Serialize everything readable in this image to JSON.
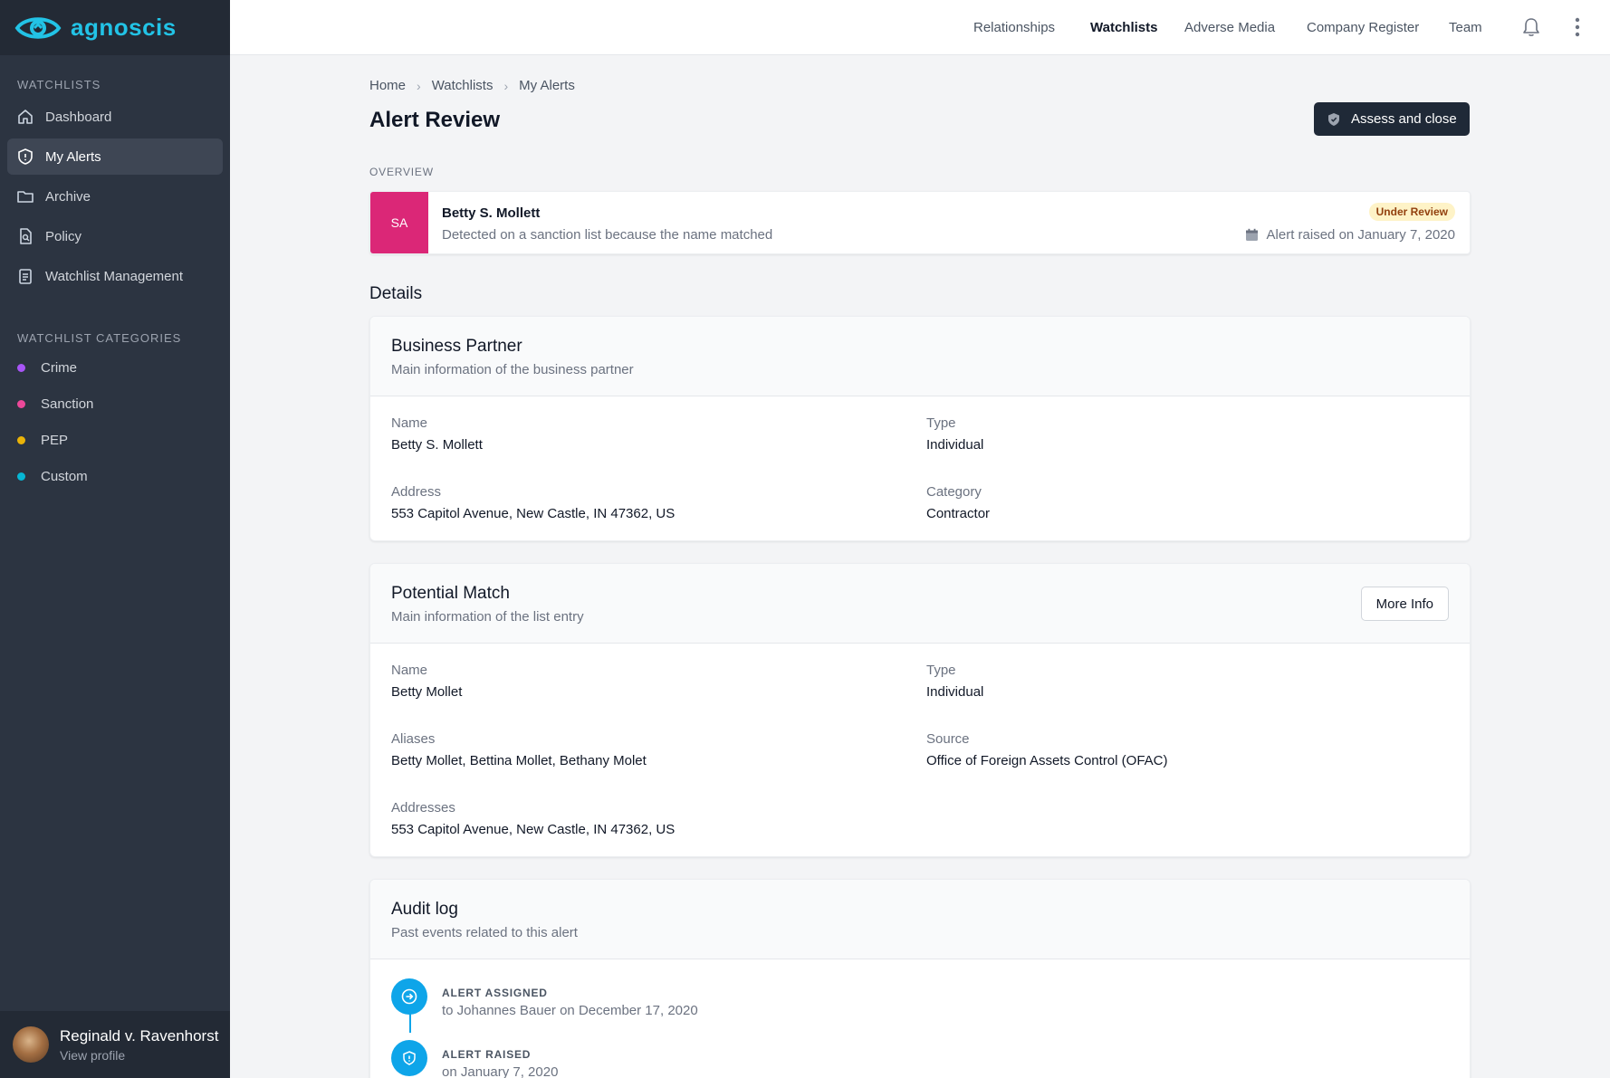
{
  "app": {
    "logo_text": "agnoscis"
  },
  "sidebar": {
    "section_watchlists": "WATCHLISTS",
    "items": [
      {
        "label": "Dashboard",
        "icon": "home-icon"
      },
      {
        "label": "My Alerts",
        "icon": "shield-icon",
        "active": true
      },
      {
        "label": "Archive",
        "icon": "folder-icon"
      },
      {
        "label": "Policy",
        "icon": "document-search-icon"
      },
      {
        "label": "Watchlist Management",
        "icon": "clipboard-icon"
      }
    ],
    "section_categories": "WATCHLIST CATEGORIES",
    "categories": [
      {
        "label": "Crime",
        "color": "#a855f7"
      },
      {
        "label": "Sanction",
        "color": "#ec4899"
      },
      {
        "label": "PEP",
        "color": "#eab308"
      },
      {
        "label": "Custom",
        "color": "#06b6d4"
      }
    ],
    "profile": {
      "name": "Reginald v. Ravenhorst",
      "sub": "View profile"
    }
  },
  "topnav": {
    "items": [
      "Relationships",
      "Watchlists",
      "Adverse Media",
      "Company Register",
      "Team"
    ],
    "active": "Watchlists"
  },
  "breadcrumb": [
    "Home",
    "Watchlists",
    "My Alerts"
  ],
  "page": {
    "title": "Alert Review",
    "primary_action": "Assess and close",
    "overview_label": "OVERVIEW"
  },
  "overview": {
    "badge": "SA",
    "badge_color": "#db2777",
    "name": "Betty S. Mollett",
    "description": "Detected on a sanction list because the name matched",
    "status": "Under Review",
    "date": "Alert raised on January 7, 2020"
  },
  "details_title": "Details",
  "business_partner": {
    "title": "Business Partner",
    "subtitle": "Main information of the business partner",
    "name_label": "Name",
    "name_value": "Betty S. Mollett",
    "type_label": "Type",
    "type_value": "Individual",
    "address_label": "Address",
    "address_value": "553 Capitol Avenue, New Castle, IN 47362, US",
    "category_label": "Category",
    "category_value": "Contractor"
  },
  "potential_match": {
    "title": "Potential Match",
    "subtitle": "Main information of the list entry",
    "button": "More Info",
    "name_label": "Name",
    "name_value": "Betty Mollet",
    "type_label": "Type",
    "type_value": "Individual",
    "aliases_label": "Aliases",
    "aliases_value": "Betty Mollet, Bettina Mollet, Bethany Molet",
    "source_label": "Source",
    "source_value": "Office of Foreign Assets Control (OFAC)",
    "addresses_label": "Addresses",
    "addresses_value": "553 Capitol Avenue, New Castle, IN 47362, US"
  },
  "audit_log": {
    "title": "Audit log",
    "subtitle": "Past events related to this alert",
    "events": [
      {
        "title": "ALERT ASSIGNED",
        "desc": "to Johannes Bauer on December 17, 2020",
        "icon": "arrow-circle-right-icon"
      },
      {
        "title": "ALERT RAISED",
        "desc": "on January 7, 2020",
        "icon": "shield-icon"
      }
    ]
  }
}
